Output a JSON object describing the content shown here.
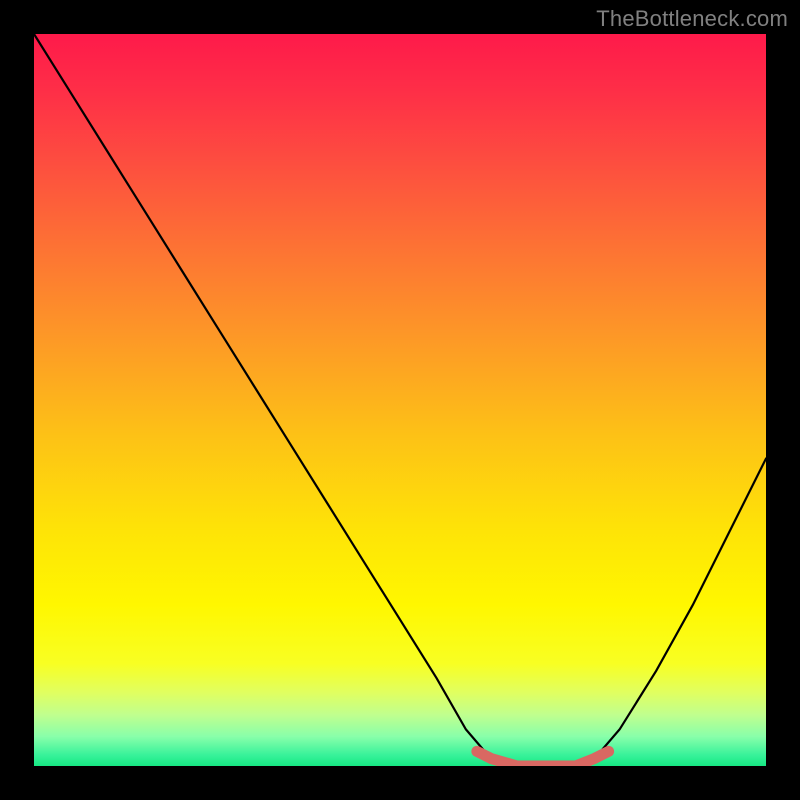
{
  "watermark": "TheBottleneck.com",
  "colors": {
    "frame": "#000000",
    "curve": "#000000",
    "marker": "#d96862",
    "gradient_stops": [
      {
        "offset": 0.0,
        "color": "#fe1a4a"
      },
      {
        "offset": 0.08,
        "color": "#fe2f47"
      },
      {
        "offset": 0.18,
        "color": "#fd4f3f"
      },
      {
        "offset": 0.3,
        "color": "#fd7533"
      },
      {
        "offset": 0.42,
        "color": "#fd9a26"
      },
      {
        "offset": 0.55,
        "color": "#fdc216"
      },
      {
        "offset": 0.68,
        "color": "#fee407"
      },
      {
        "offset": 0.78,
        "color": "#fff700"
      },
      {
        "offset": 0.86,
        "color": "#f8ff23"
      },
      {
        "offset": 0.9,
        "color": "#e0ff61"
      },
      {
        "offset": 0.93,
        "color": "#c0ff8e"
      },
      {
        "offset": 0.96,
        "color": "#88ffaa"
      },
      {
        "offset": 0.985,
        "color": "#38f29a"
      },
      {
        "offset": 1.0,
        "color": "#16e883"
      }
    ]
  },
  "chart_data": {
    "type": "line",
    "title": "",
    "xlabel": "",
    "ylabel": "",
    "xlim": [
      0,
      1
    ],
    "ylim": [
      0,
      100
    ],
    "series": [
      {
        "name": "bottleneck-curve",
        "x": [
          0.0,
          0.05,
          0.1,
          0.15,
          0.2,
          0.25,
          0.3,
          0.35,
          0.4,
          0.45,
          0.5,
          0.55,
          0.59,
          0.62,
          0.66,
          0.7,
          0.74,
          0.77,
          0.8,
          0.85,
          0.9,
          0.95,
          1.0
        ],
        "values": [
          100,
          92,
          84,
          76,
          68,
          60,
          52,
          44,
          36,
          28,
          20,
          12,
          5,
          1.5,
          0,
          0,
          0,
          1.5,
          5,
          13,
          22,
          32,
          42
        ]
      }
    ],
    "highlight": {
      "name": "optimal-range",
      "x": [
        0.605,
        0.625,
        0.66,
        0.7,
        0.74,
        0.765,
        0.785
      ],
      "values": [
        2.0,
        1.0,
        0.0,
        0.0,
        0.0,
        1.0,
        2.0
      ]
    }
  }
}
